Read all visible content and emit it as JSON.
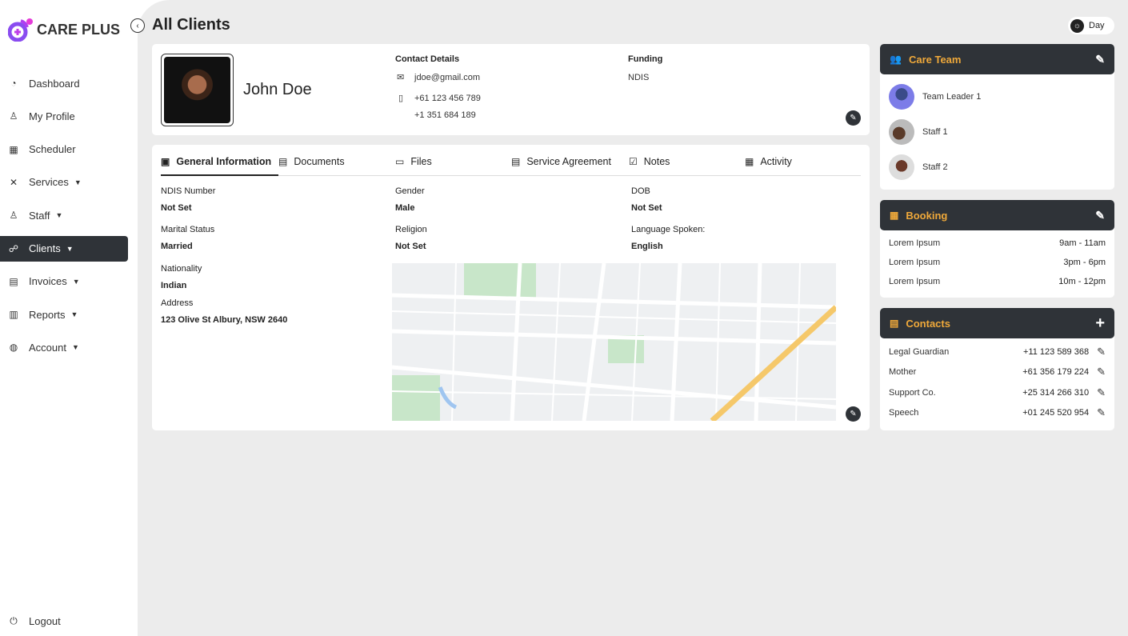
{
  "app": {
    "name": "CARE PLUS"
  },
  "sidebar": {
    "items": [
      {
        "label": "Dashboard",
        "icon": "gauge-icon"
      },
      {
        "label": "My Profile",
        "icon": "user-icon"
      },
      {
        "label": "Scheduler",
        "icon": "calendar-icon"
      },
      {
        "label": "Services",
        "icon": "tools-icon",
        "expandable": true
      },
      {
        "label": "Staff",
        "icon": "user-icon",
        "expandable": true
      },
      {
        "label": "Clients",
        "icon": "users-icon",
        "expandable": true,
        "active": true
      },
      {
        "label": "Invoices",
        "icon": "invoice-icon",
        "expandable": true
      },
      {
        "label": "Reports",
        "icon": "chart-icon",
        "expandable": true
      },
      {
        "label": "Account",
        "icon": "globe-icon",
        "expandable": true
      }
    ],
    "logout": "Logout"
  },
  "header": {
    "title": "All Clients",
    "theme_label": "Day"
  },
  "client": {
    "name": "John Doe",
    "contact_title": "Contact Details",
    "email": "jdoe@gmail.com",
    "phone1": "+61 123 456 789",
    "phone2": "+1 351 684 189",
    "funding_title": "Funding",
    "funding": "NDIS"
  },
  "tabs": [
    "General Information",
    "Documents",
    "Files",
    "Service Agreement",
    "Notes",
    "Activity"
  ],
  "info": {
    "ndis_label": "NDIS Number",
    "ndis": "Not Set",
    "gender_label": "Gender",
    "gender": "Male",
    "dob_label": "DOB",
    "dob": "Not Set",
    "marital_label": "Marital Status",
    "marital": "Married",
    "religion_label": "Religion",
    "religion": "Not Set",
    "language_label": "Language Spoken:",
    "language": "English",
    "nationality_label": "Nationality",
    "nationality": "Indian",
    "address_label": "Address",
    "address": "123 Olive St Albury, NSW 2640"
  },
  "care_team": {
    "title": "Care Team",
    "members": [
      "Team Leader 1",
      "Staff 1",
      "Staff 2"
    ]
  },
  "booking": {
    "title": "Booking",
    "rows": [
      {
        "name": "Lorem Ipsum",
        "time": "9am - 11am"
      },
      {
        "name": "Lorem Ipsum",
        "time": "3pm - 6pm"
      },
      {
        "name": "Lorem Ipsum",
        "time": "10m - 12pm"
      }
    ]
  },
  "contacts": {
    "title": "Contacts",
    "rows": [
      {
        "name": "Legal Guardian",
        "phone": "+11 123 589 368"
      },
      {
        "name": "Mother",
        "phone": "+61 356 179 224"
      },
      {
        "name": "Support Co.",
        "phone": "+25 314 266 310"
      },
      {
        "name": "Speech",
        "phone": "+01 245 520 954"
      }
    ]
  },
  "colors": {
    "accent": "#f0a93a",
    "dark": "#2f3338",
    "brand": "#a63cf0"
  }
}
